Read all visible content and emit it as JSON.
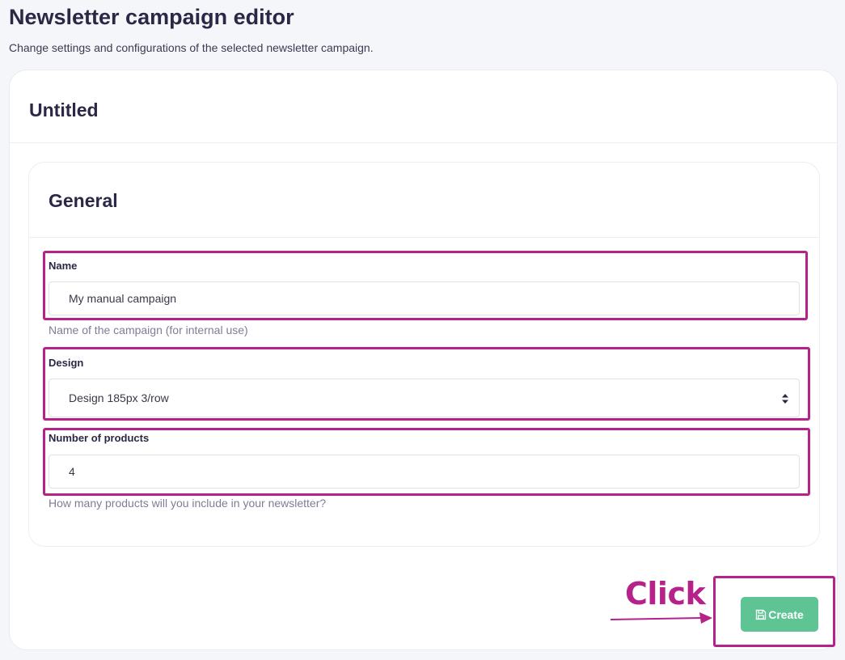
{
  "page": {
    "title": "Newsletter campaign editor",
    "subtitle": "Change settings and configurations of the selected newsletter campaign."
  },
  "campaign": {
    "title": "Untitled"
  },
  "general": {
    "title": "General",
    "fields": {
      "name": {
        "label": "Name",
        "value": "My manual campaign",
        "help": "Name of the campaign (for internal use)"
      },
      "design": {
        "label": "Design",
        "selected": "Design 185px 3/row"
      },
      "products": {
        "label": "Number of products",
        "value": "4",
        "help": "How many products will you include in your newsletter?"
      }
    }
  },
  "actions": {
    "create_label": "Create"
  },
  "annotation": {
    "text": "Click",
    "color": "#b5238a"
  },
  "colors": {
    "button": "#5ec494",
    "heading": "#2b2845"
  },
  "icons": {
    "save": "save-icon",
    "select": "sort-caret-icon"
  }
}
